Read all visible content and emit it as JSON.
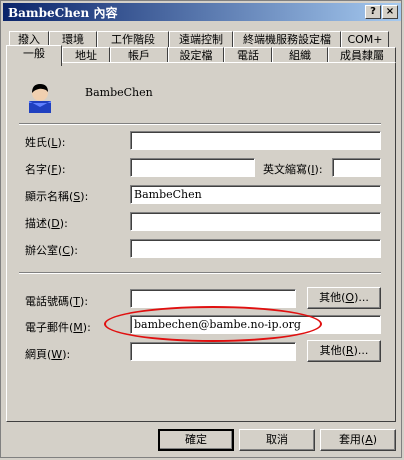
{
  "window": {
    "title": "BambeChen 內容",
    "help_btn": "?",
    "close_btn": "×"
  },
  "tabs_row1": [
    "撥入",
    "環境",
    "工作階段",
    "遠端控制",
    "終端機服務設定檔",
    "COM+"
  ],
  "tabs_row2": [
    "一般",
    "地址",
    "帳戶",
    "設定檔",
    "電話",
    "組織",
    "成員隸屬"
  ],
  "user": {
    "display": "BambeChen"
  },
  "fields": {
    "last_name": {
      "label": "姓氏(",
      "key": "L",
      "tail": "):",
      "value": ""
    },
    "first_name": {
      "label": "名字(",
      "key": "F",
      "tail": "):",
      "value": ""
    },
    "initials": {
      "label": "英文縮寫(",
      "key": "I",
      "tail": "):",
      "value": ""
    },
    "display_name": {
      "label": "顯示名稱(",
      "key": "S",
      "tail": "):",
      "value": "BambeChen"
    },
    "description": {
      "label": "描述(",
      "key": "D",
      "tail": "):",
      "value": ""
    },
    "office": {
      "label": "辦公室(",
      "key": "C",
      "tail": "):",
      "value": ""
    },
    "phone": {
      "label": "電話號碼(",
      "key": "T",
      "tail": "):",
      "value": ""
    },
    "email": {
      "label": "電子郵件(",
      "key": "M",
      "tail": "):",
      "value": "bambechen@bambe.no-ip.org"
    },
    "webpage": {
      "label": "網頁(",
      "key": "W",
      "tail": "):",
      "value": ""
    }
  },
  "buttons": {
    "other_phone": {
      "pre": "其他(",
      "key": "O",
      "post": ")..."
    },
    "other_web": {
      "pre": "其他(",
      "key": "R",
      "post": ")..."
    },
    "ok": "確定",
    "cancel": "取消",
    "apply": {
      "pre": "套用(",
      "key": "A",
      "post": ")"
    }
  },
  "colors": {
    "annotation": "#e01010",
    "titlebar_start": "#0a246a"
  }
}
